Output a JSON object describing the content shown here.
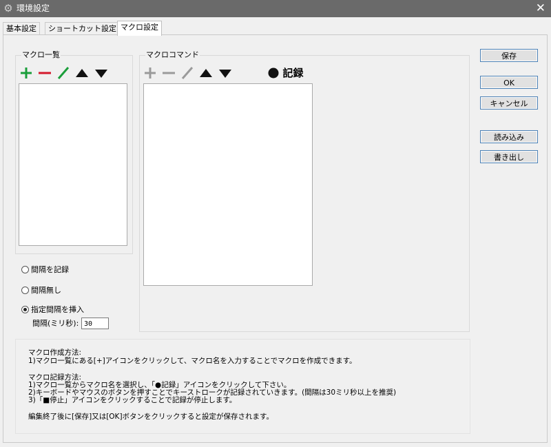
{
  "window": {
    "title": "環境設定"
  },
  "tabs": [
    {
      "label": "基本設定"
    },
    {
      "label": "ショートカット設定"
    },
    {
      "label": "マクロ設定"
    }
  ],
  "macro_list": {
    "label": "マクロ一覧"
  },
  "macro_commands": {
    "label": "マクロコマンド",
    "record_label": "記録"
  },
  "icons": {
    "add": "plus-icon",
    "remove": "minus-icon",
    "edit": "pencil-icon",
    "up": "triangle-up-icon",
    "down": "triangle-down-icon",
    "record": "record-dot-icon",
    "add_color": "#1a9e3a",
    "remove_color": "#d4182b",
    "edit_color": "#1a9e3a"
  },
  "interval_options": {
    "record": "間隔を記録",
    "none": "間隔無し",
    "insert": "指定間隔を挿入",
    "selected": "insert",
    "interval_label": "間隔(ミリ秒):",
    "interval_value": "30"
  },
  "buttons": {
    "save": "保存",
    "ok": "OK",
    "cancel": "キャンセル",
    "load": "読み込み",
    "export": "書き出し"
  },
  "help": {
    "create_title": "マクロ作成方法:",
    "create_1": "1)マクロ一覧にある[+]アイコンをクリックして、マクロ名を入力することでマクロを作成できます。",
    "record_title": "マクロ記録方法:",
    "record_1": "1)マクロ一覧からマクロ名を選択し、「●記録」アイコンをクリックして下さい。",
    "record_2": "2)キーボードやマウスのボタンを押すことでキーストロークが記録されていきます。(間隔は30ミリ秒以上を推奨)",
    "record_3": "3)「■停止」アイコンをクリックすることで記録が停止します。",
    "footer": "編集終了後に[保存]又は[OK]ボタンをクリックすると設定が保存されます。"
  }
}
